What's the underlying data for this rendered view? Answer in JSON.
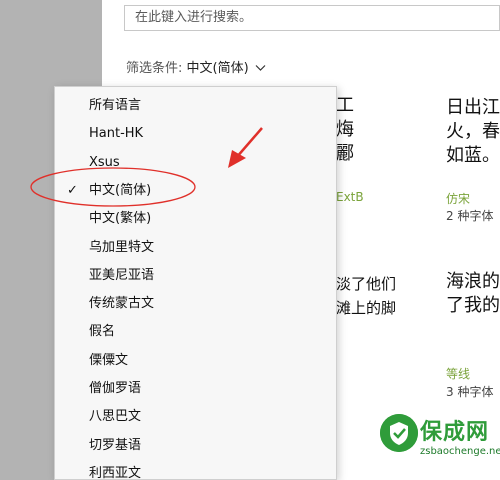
{
  "search": {
    "placeholder": "在此键入进行搜索。"
  },
  "filter": {
    "label": "筛选条件: ",
    "value": "中文(简体)",
    "chevron_icon": "chevron-down-icon"
  },
  "cards": [
    {
      "preview": "工\n烸\n酈",
      "name": "ExtB",
      "count": ""
    },
    {
      "preview": "日出江\n火，春\n如蓝。",
      "name": "仿宋",
      "count": "2 种字体"
    },
    {
      "preview": "淡了他们\n滩上的脚",
      "name": "",
      "count": ""
    },
    {
      "preview": "海浪的\n了我的",
      "name": "等线",
      "count": "3 种字体"
    }
  ],
  "dropdown": {
    "items": [
      {
        "label": "所有语言",
        "checked": false
      },
      {
        "label": "Hant-HK",
        "checked": false
      },
      {
        "label": "Xsus",
        "checked": false
      },
      {
        "label": "中文(简体)",
        "checked": true
      },
      {
        "label": "中文(繁体)",
        "checked": false
      },
      {
        "label": "乌加里特文",
        "checked": false
      },
      {
        "label": "亚美尼亚语",
        "checked": false
      },
      {
        "label": "传统蒙古文",
        "checked": false
      },
      {
        "label": "假名",
        "checked": false
      },
      {
        "label": "傈僳文",
        "checked": false
      },
      {
        "label": "僧伽罗语",
        "checked": false
      },
      {
        "label": "八思巴文",
        "checked": false
      },
      {
        "label": "切罗基语",
        "checked": false
      },
      {
        "label": "利西亚文",
        "checked": false
      }
    ],
    "check_glyph": "✓"
  },
  "annotation": {
    "color": "#e0302a"
  },
  "watermark": {
    "name": "保成网",
    "url": "zsbaochenge.net",
    "color": "#2f9c3a"
  }
}
